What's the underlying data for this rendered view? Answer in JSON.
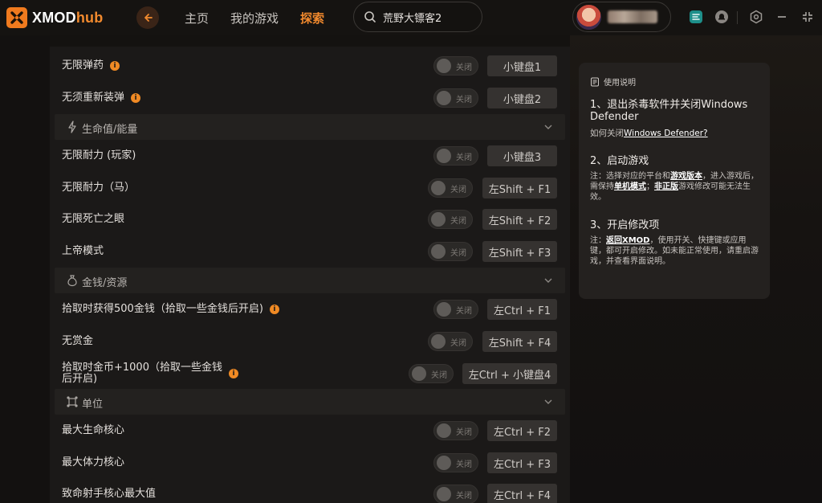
{
  "app": {
    "logo_x": "XMOD",
    "logo_hub": "hub",
    "brand_color": "#f28a2e"
  },
  "nav": {
    "home": "主页",
    "my_games": "我的游戏",
    "explore": "探索"
  },
  "search": {
    "value": "荒野大镖客2"
  },
  "header_icons": [
    "collapse-panel-icon",
    "notification-icon",
    "settings-icon",
    "minimize-icon",
    "close-icon"
  ],
  "toggle_off_label": "关闭",
  "rows": [
    {
      "label": "无限弹药",
      "info": "i",
      "key": "小键盘1"
    },
    {
      "label": "无须重新装弹",
      "info": "i",
      "key": "小键盘2"
    },
    {
      "label": "无限耐力 (玩家)",
      "key": "小键盘3"
    },
    {
      "label": "无限耐力（马）",
      "key": "左Shift + F1"
    },
    {
      "label": "无限死亡之眼",
      "key": "左Shift + F2"
    },
    {
      "label": "上帝模式",
      "key": "左Shift + F3"
    },
    {
      "label": "拾取时获得500金钱（拾取一些金钱后开启)",
      "info": "i",
      "key": "左Ctrl + F1"
    },
    {
      "label": "无赏金",
      "key": "左Shift + F4"
    },
    {
      "label": "拾取时金币+1000（拾取一些金钱后开启)",
      "info": "i",
      "key": "左Ctrl + 小键盘4"
    },
    {
      "label": "最大生命核心",
      "key": "左Ctrl + F2"
    },
    {
      "label": "最大体力核心",
      "key": "左Ctrl + F3"
    },
    {
      "label": "致命射手核心最大值",
      "key": "左Ctrl + F4"
    }
  ],
  "sections": [
    {
      "title": "生命值/能量"
    },
    {
      "title": "金钱/资源"
    },
    {
      "title": "单位"
    }
  ],
  "help": {
    "title": "使用说明",
    "step1_title": "1、退出杀毒软件并关闭Windows Defender",
    "step1_link_prefix": "如何关闭",
    "step1_link": "Windows Defender?",
    "step2_title": "2、启动游戏",
    "step2_text": {
      "a": "注：选择对应的平台和",
      "b": "游戏版本",
      "c": "，进入游戏后，需保持",
      "d": "单机模式",
      "e": "；",
      "f": "非正版",
      "g": "游戏修改可能无法生效。"
    },
    "step3_title": "3、开启修改项",
    "step3_text": {
      "a": "注：",
      "b": "返回XMOD",
      "c": "，使用开关、快捷键或应用键，都可开启修改。如未能正常使用，请重启游戏，并查看界面说明。"
    }
  }
}
